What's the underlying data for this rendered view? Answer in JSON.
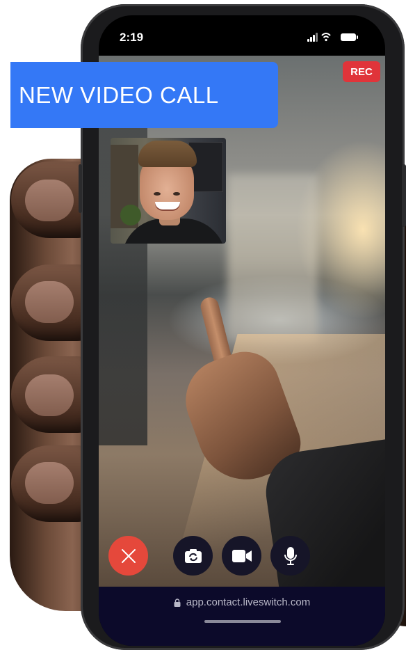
{
  "status_bar": {
    "time": "2:19"
  },
  "banner": {
    "title": "NEW VIDEO CALL",
    "color": "#3478f6"
  },
  "recording_badge": {
    "label": "REC",
    "color": "#e0343a"
  },
  "controls": {
    "end_call": {
      "icon": "close-icon",
      "color": "#e5483b"
    },
    "switch_camera": {
      "icon": "camera-switch-icon"
    },
    "video": {
      "icon": "video-camera-icon"
    },
    "microphone": {
      "icon": "microphone-icon"
    }
  },
  "url_bar": {
    "url": "app.contact.liveswitch.com",
    "icon": "lock-icon"
  }
}
